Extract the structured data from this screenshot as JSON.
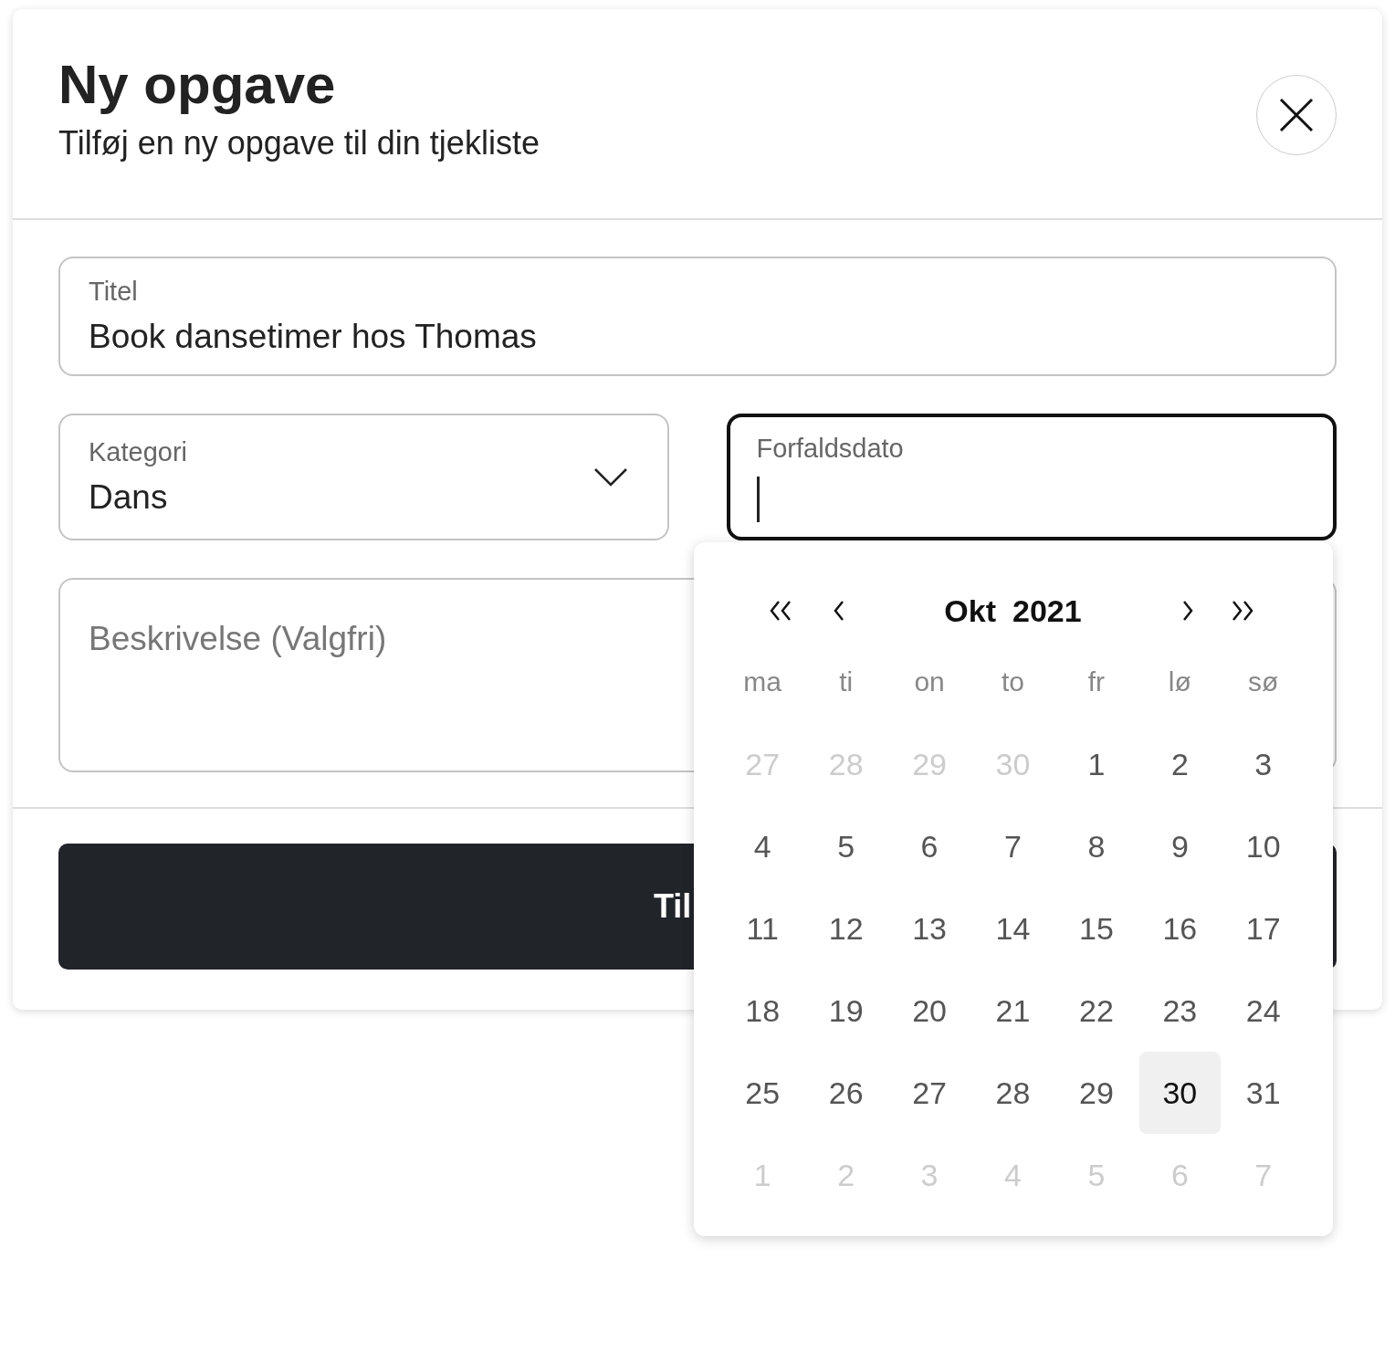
{
  "dialog": {
    "title": "Ny opgave",
    "subtitle": "Tilføj en ny opgave til din tjekliste"
  },
  "fields": {
    "title": {
      "label": "Titel",
      "value": "Book dansetimer hos Thomas"
    },
    "category": {
      "label": "Kategori",
      "value": "Dans"
    },
    "due_date": {
      "label": "Forfaldsdato",
      "focused": true
    },
    "description": {
      "placeholder": "Beskrivelse (Valgfri)"
    }
  },
  "submit_button": {
    "label": "Til"
  },
  "datepicker": {
    "month": "Okt",
    "year": "2021",
    "weekdays": [
      "ma",
      "ti",
      "on",
      "to",
      "fr",
      "lø",
      "sø"
    ],
    "days": [
      {
        "label": "27",
        "outside": true,
        "selected": false
      },
      {
        "label": "28",
        "outside": true,
        "selected": false
      },
      {
        "label": "29",
        "outside": true,
        "selected": false
      },
      {
        "label": "30",
        "outside": true,
        "selected": false
      },
      {
        "label": "1",
        "outside": false,
        "selected": false
      },
      {
        "label": "2",
        "outside": false,
        "selected": false
      },
      {
        "label": "3",
        "outside": false,
        "selected": false
      },
      {
        "label": "4",
        "outside": false,
        "selected": false
      },
      {
        "label": "5",
        "outside": false,
        "selected": false
      },
      {
        "label": "6",
        "outside": false,
        "selected": false
      },
      {
        "label": "7",
        "outside": false,
        "selected": false
      },
      {
        "label": "8",
        "outside": false,
        "selected": false
      },
      {
        "label": "9",
        "outside": false,
        "selected": false
      },
      {
        "label": "10",
        "outside": false,
        "selected": false
      },
      {
        "label": "11",
        "outside": false,
        "selected": false
      },
      {
        "label": "12",
        "outside": false,
        "selected": false
      },
      {
        "label": "13",
        "outside": false,
        "selected": false
      },
      {
        "label": "14",
        "outside": false,
        "selected": false
      },
      {
        "label": "15",
        "outside": false,
        "selected": false
      },
      {
        "label": "16",
        "outside": false,
        "selected": false
      },
      {
        "label": "17",
        "outside": false,
        "selected": false
      },
      {
        "label": "18",
        "outside": false,
        "selected": false
      },
      {
        "label": "19",
        "outside": false,
        "selected": false
      },
      {
        "label": "20",
        "outside": false,
        "selected": false
      },
      {
        "label": "21",
        "outside": false,
        "selected": false
      },
      {
        "label": "22",
        "outside": false,
        "selected": false
      },
      {
        "label": "23",
        "outside": false,
        "selected": false
      },
      {
        "label": "24",
        "outside": false,
        "selected": false
      },
      {
        "label": "25",
        "outside": false,
        "selected": false
      },
      {
        "label": "26",
        "outside": false,
        "selected": false
      },
      {
        "label": "27",
        "outside": false,
        "selected": false
      },
      {
        "label": "28",
        "outside": false,
        "selected": false
      },
      {
        "label": "29",
        "outside": false,
        "selected": false
      },
      {
        "label": "30",
        "outside": false,
        "selected": true
      },
      {
        "label": "31",
        "outside": false,
        "selected": false
      },
      {
        "label": "1",
        "outside": true,
        "selected": false
      },
      {
        "label": "2",
        "outside": true,
        "selected": false
      },
      {
        "label": "3",
        "outside": true,
        "selected": false
      },
      {
        "label": "4",
        "outside": true,
        "selected": false
      },
      {
        "label": "5",
        "outside": true,
        "selected": false
      },
      {
        "label": "6",
        "outside": true,
        "selected": false
      },
      {
        "label": "7",
        "outside": true,
        "selected": false
      }
    ]
  }
}
